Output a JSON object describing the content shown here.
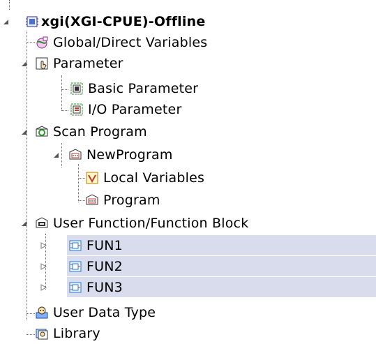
{
  "tree": {
    "root": {
      "label": "xgi(XGI-CPUE)-Offline",
      "icon": "cpu-icon"
    },
    "items": [
      {
        "label": "Global/Direct Variables",
        "icon": "global-variables-icon"
      },
      {
        "label": "Parameter",
        "icon": "parameter-icon"
      },
      {
        "label": "Basic Parameter",
        "icon": "basic-parameter-icon"
      },
      {
        "label": "I/O Parameter",
        "icon": "io-parameter-icon"
      },
      {
        "label": "Scan Program",
        "icon": "scan-program-icon"
      },
      {
        "label": "NewProgram",
        "icon": "program-folder-icon"
      },
      {
        "label": "Local Variables",
        "icon": "local-variables-icon"
      },
      {
        "label": "Program",
        "icon": "program-icon"
      },
      {
        "label": "User Function/Function Block",
        "icon": "user-function-icon"
      },
      {
        "label": "FUN1",
        "icon": "function-icon"
      },
      {
        "label": "FUN2",
        "icon": "function-icon"
      },
      {
        "label": "FUN3",
        "icon": "function-icon"
      },
      {
        "label": "User Data Type",
        "icon": "user-data-type-icon"
      },
      {
        "label": "Library",
        "icon": "library-icon"
      }
    ]
  },
  "colors": {
    "selection": "#d8dcec",
    "accent_green": "#3a9a3a",
    "accent_red": "#c0392b"
  }
}
